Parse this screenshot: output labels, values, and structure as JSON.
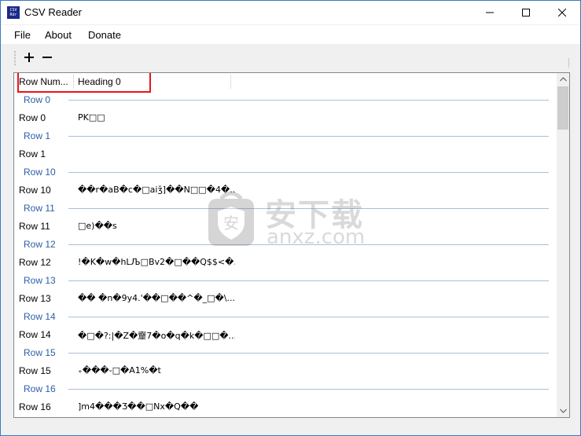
{
  "window": {
    "title": "CSV Reader",
    "icon_text": "CSV\nReader"
  },
  "menu": {
    "items": [
      {
        "label": "File"
      },
      {
        "label": "About"
      },
      {
        "label": "Donate"
      }
    ]
  },
  "toolbar": {
    "add_icon": "plus-icon",
    "remove_icon": "minus-icon"
  },
  "grid": {
    "columns": [
      {
        "label": "Row Num..."
      },
      {
        "label": "Heading 0"
      }
    ],
    "groups": [
      {
        "label": "Row 0",
        "row": {
          "rownum": "Row 0",
          "h0": "PK□□"
        }
      },
      {
        "label": "Row 1",
        "row": {
          "rownum": "Row 1",
          "h0": ""
        }
      },
      {
        "label": "Row 10",
        "row": {
          "rownum": "Row 10",
          "h0": "��r�aB�c�□aiǯ]��N□□�4�..."
        }
      },
      {
        "label": "Row 11",
        "row": {
          "rownum": "Row 11",
          "h0": "□e)��s"
        }
      },
      {
        "label": "Row 12",
        "row": {
          "rownum": "Row 12",
          "h0": "!�K�w�hLЉ□Bv2�□��Q$$<�..."
        }
      },
      {
        "label": "Row 13",
        "row": {
          "rownum": "Row 13",
          "h0": "�� �n�9y4.'��□��^�_□�\\..."
        }
      },
      {
        "label": "Row 14",
        "row": {
          "rownum": "Row 14",
          "h0": "�□�?:|�Z�齏7�o�q�k�□□�..."
        }
      },
      {
        "label": "Row 15",
        "row": {
          "rownum": "Row 15",
          "h0": "₊���-□�A1%�t"
        }
      },
      {
        "label": "Row 16",
        "row": {
          "rownum": "Row 16",
          "h0": "]m4���Ʒ��□Nx�Q��"
        }
      }
    ]
  },
  "watermark": {
    "main": "安下载",
    "sub": "anxz.com"
  },
  "colors": {
    "group_label": "#2a5fa8",
    "group_line": "#a9bfd8",
    "highlight": "#e8141b",
    "window_border": "#3a78c4"
  }
}
